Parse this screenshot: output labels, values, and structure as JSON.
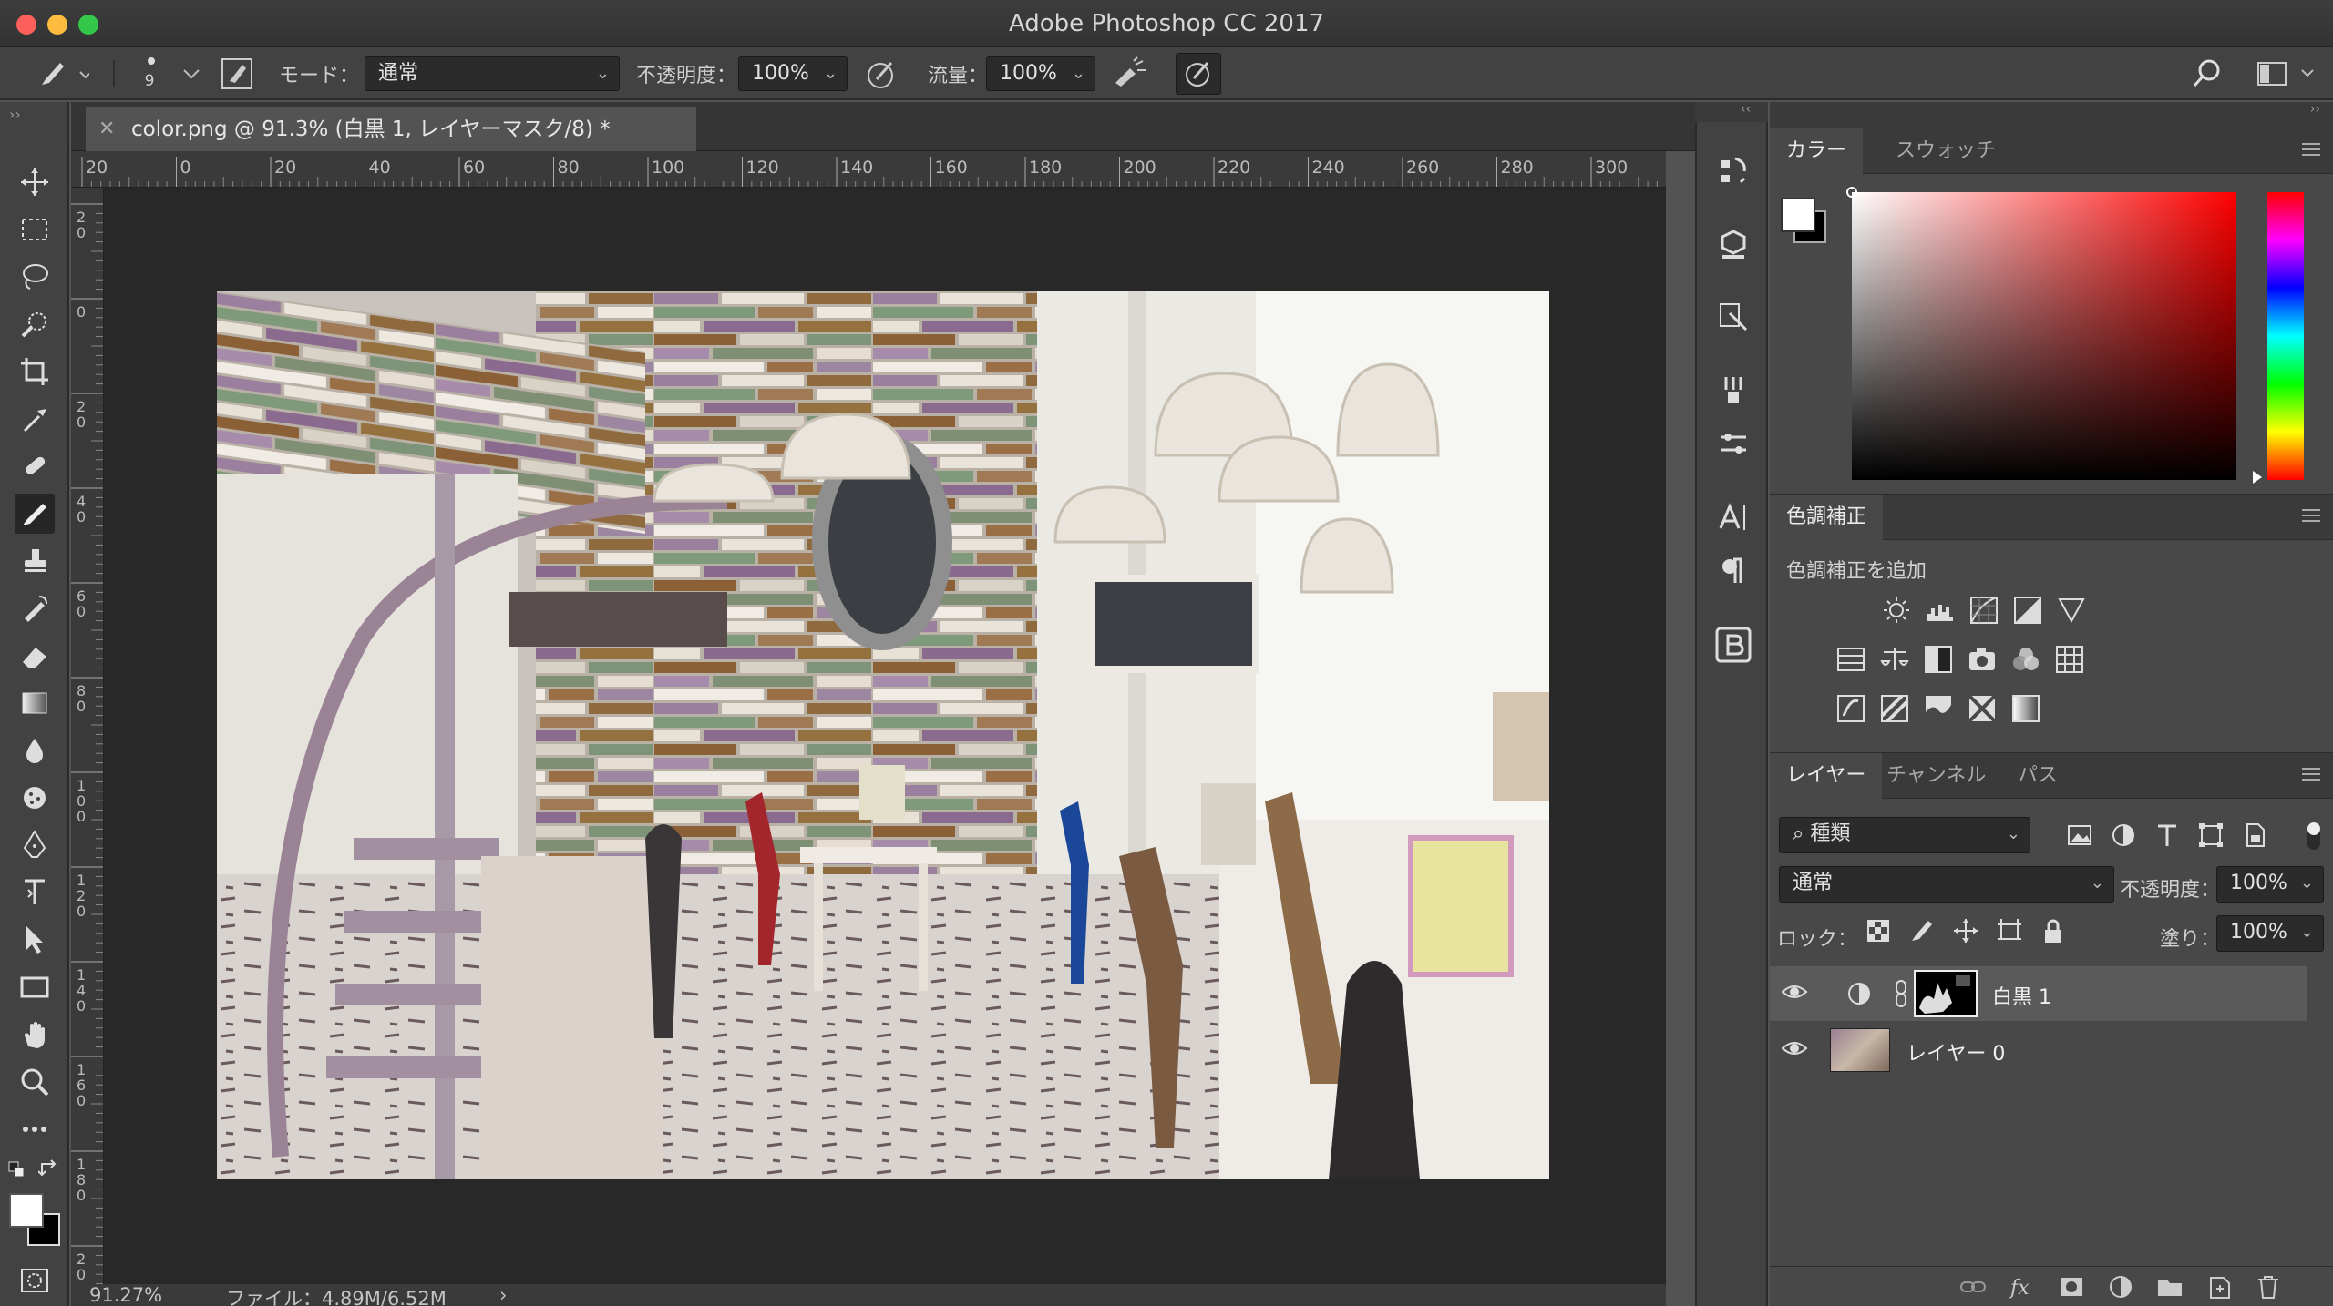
{
  "window": {
    "title": "Adobe Photoshop CC 2017"
  },
  "options": {
    "brush_size": "9",
    "mode_label": "モード：",
    "mode_value": "通常",
    "opacity_label": "不透明度：",
    "opacity_value": "100%",
    "flow_label": "流量：",
    "flow_value": "100%"
  },
  "document": {
    "tab_title": "color.png @ 91.3% (白黒 1, レイヤーマスク/8) *",
    "zoom": "91.27%",
    "file_info": "ファイル：4.89M/6.52M"
  },
  "rulers": {
    "top": [
      "20",
      "0",
      "20",
      "40",
      "60",
      "80",
      "100",
      "120",
      "140",
      "160",
      "180",
      "200",
      "220",
      "240",
      "260",
      "280",
      "300"
    ],
    "left": [
      "2\n0",
      "0",
      "2\n0",
      "4\n0",
      "6\n0",
      "8\n0",
      "1\n0\n0",
      "1\n2\n0",
      "1\n4\n0",
      "1\n6\n0",
      "1\n8\n0",
      "2\n0\n0"
    ]
  },
  "panels": {
    "color": {
      "tabs": [
        "カラー",
        "スウォッチ"
      ]
    },
    "adjustments": {
      "tab": "色調補正",
      "add_label": "色調補正を追加"
    },
    "layers": {
      "tabs": [
        "レイヤー",
        "チャンネル",
        "パス"
      ],
      "filter_kind": "種類",
      "blend_mode": "通常",
      "opacity_label": "不透明度：",
      "opacity_value": "100%",
      "lock_label": "ロック：",
      "fill_label": "塗り：",
      "fill_value": "100%",
      "items": [
        {
          "name": "白黒 1"
        },
        {
          "name": "レイヤー 0"
        }
      ]
    }
  },
  "colors": {
    "foreground": "#ffffff",
    "background": "#000000",
    "picker_hue": "#ff0000"
  }
}
